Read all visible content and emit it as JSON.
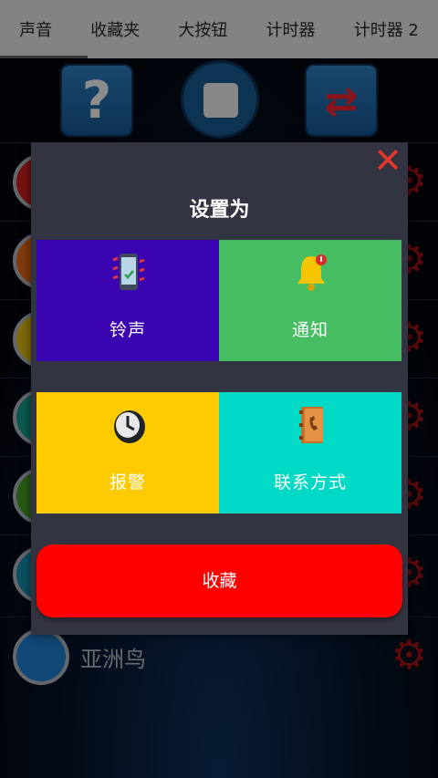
{
  "tabs": [
    {
      "label": "声音"
    },
    {
      "label": "收藏夹"
    },
    {
      "label": "大按钮"
    },
    {
      "label": "计时器"
    },
    {
      "label": "计时器 2"
    }
  ],
  "sounds": {
    "visible_name": "亚洲鸟",
    "ball_colors": [
      "#b51c1c",
      "#c95a14",
      "#c7a514",
      "#138a78",
      "#3d8a20",
      "#137f9a",
      "#1c6fb5"
    ]
  },
  "dialog": {
    "title": "设置为",
    "close_icon": "close-icon",
    "tiles": [
      {
        "label": "铃声",
        "icon": "phone-ringing-icon",
        "color": "#3a05b0"
      },
      {
        "label": "通知",
        "icon": "bell-icon",
        "color": "#46bd63"
      },
      {
        "label": "报警",
        "icon": "clock-icon",
        "color": "#ffcb00"
      },
      {
        "label": "联系方式",
        "icon": "contact-book-icon",
        "color": "#00d9c5"
      }
    ],
    "favorite_label": "收藏"
  },
  "colors": {
    "accent_red": "#ff0000",
    "dialog_bg": "#333441"
  }
}
